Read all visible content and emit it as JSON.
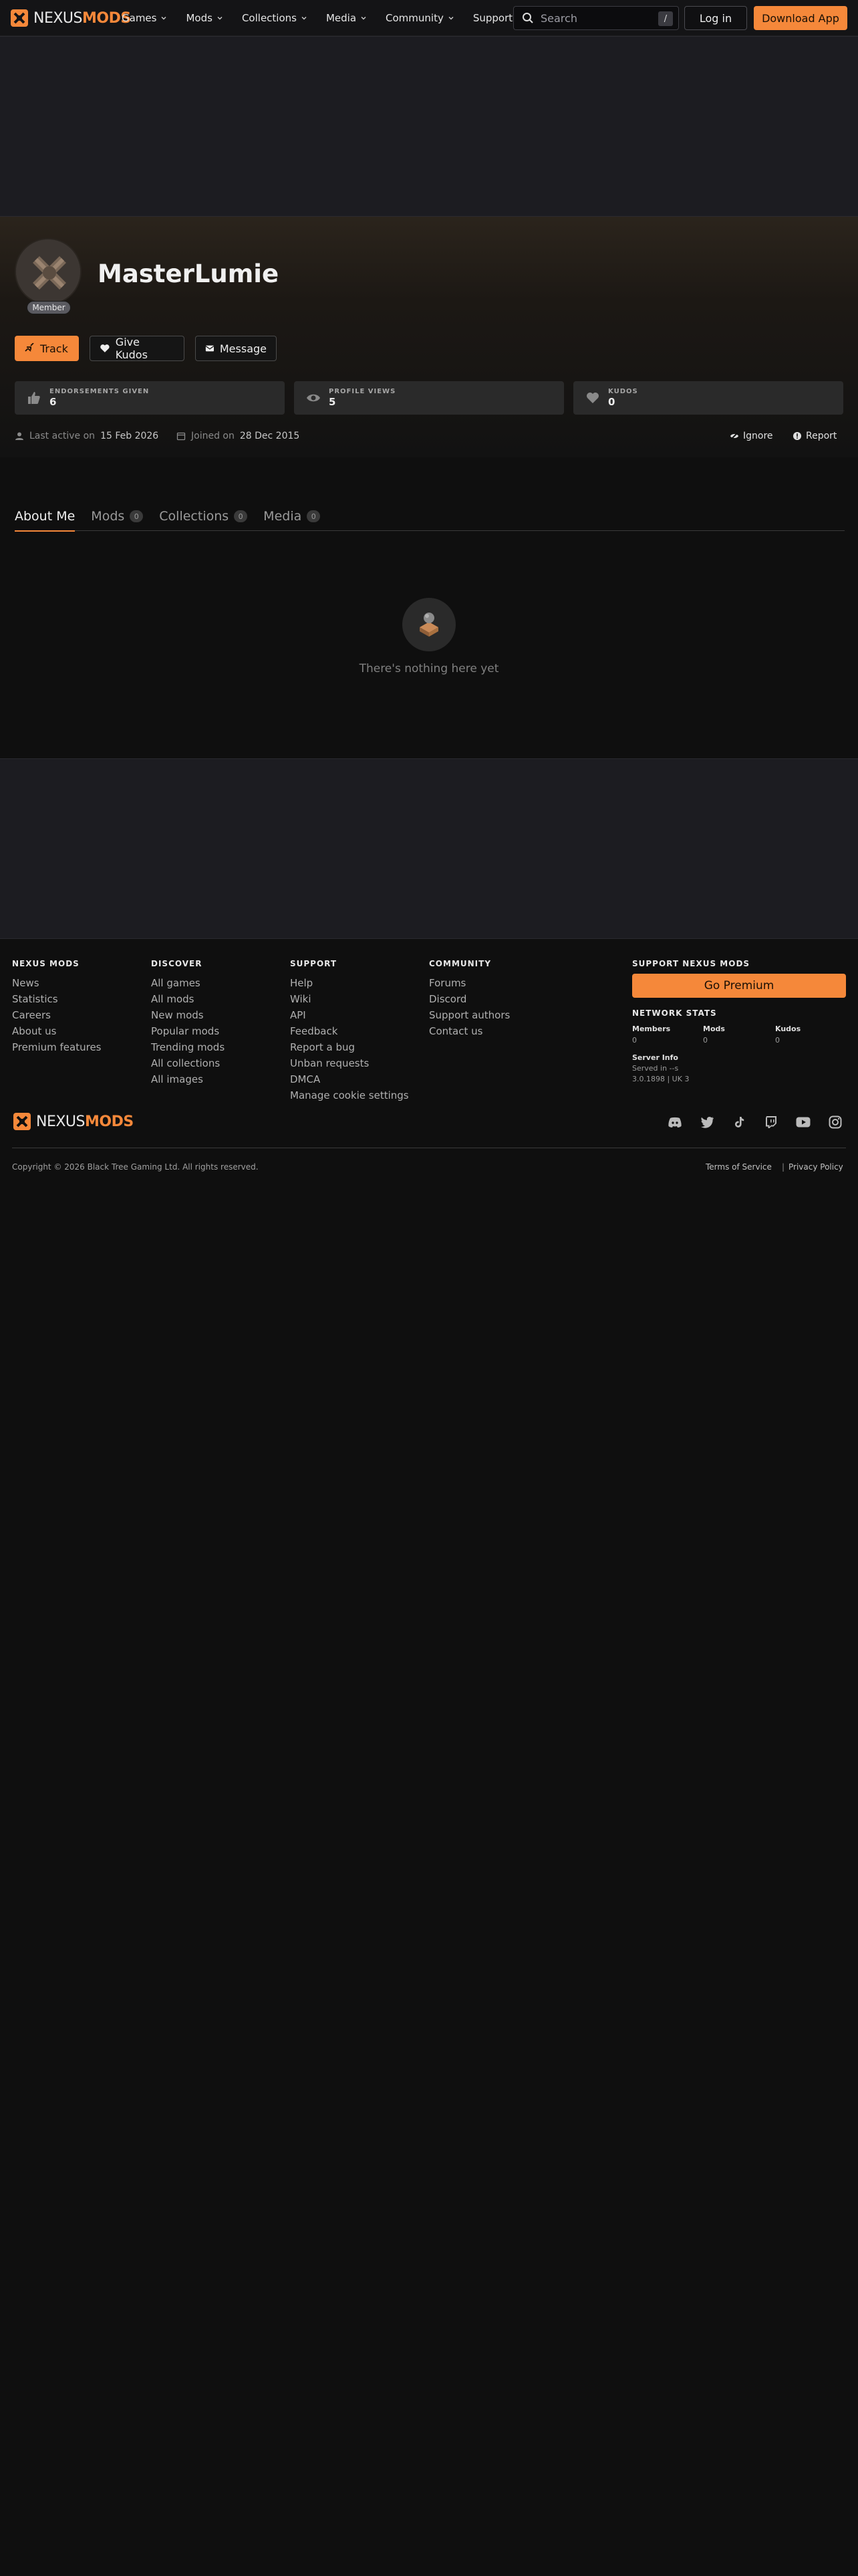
{
  "nav": {
    "logo_nexus": "NEXUS",
    "logo_mods": "MODS",
    "menu": [
      {
        "label": "Games"
      },
      {
        "label": "Mods"
      },
      {
        "label": "Collections"
      },
      {
        "label": "Media"
      },
      {
        "label": "Community"
      },
      {
        "label": "Support"
      }
    ],
    "search_placeholder": "Search",
    "search_shortcut": "/",
    "login_label": "Log in",
    "download_label": "Download App"
  },
  "profile": {
    "username": "MasterLumie",
    "role_badge": "Member",
    "actions": {
      "track": "Track",
      "kudos": "Give Kudos",
      "message": "Message"
    },
    "stats": [
      {
        "label": "ENDORSEMENTS GIVEN",
        "value": "6",
        "icon": "thumbs-up-icon"
      },
      {
        "label": "PROFILE VIEWS",
        "value": "5",
        "icon": "eye-icon"
      },
      {
        "label": "KUDOS",
        "value": "0",
        "icon": "heart-icon"
      }
    ],
    "last_active_label": "Last active on",
    "last_active_value": "15 Feb 2026",
    "joined_label": "Joined on",
    "joined_value": "28 Dec 2015",
    "ignore_label": "Ignore",
    "report_label": "Report"
  },
  "tabs": [
    {
      "label": "About Me",
      "count": "",
      "active": true
    },
    {
      "label": "Mods",
      "count": "0",
      "active": false
    },
    {
      "label": "Collections",
      "count": "0",
      "active": false
    },
    {
      "label": "Media",
      "count": "0",
      "active": false
    }
  ],
  "empty_state": {
    "text": "There's nothing here yet"
  },
  "footer": {
    "columns": [
      {
        "title": "NEXUS MODS",
        "links": [
          "News",
          "Statistics",
          "Careers",
          "About us",
          "Premium features"
        ]
      },
      {
        "title": "DISCOVER",
        "links": [
          "All games",
          "All mods",
          "New mods",
          "Popular mods",
          "Trending mods",
          "All collections",
          "All images"
        ]
      },
      {
        "title": "SUPPORT",
        "links": [
          "Help",
          "Wiki",
          "API",
          "Feedback",
          "Report a bug",
          "Unban requests",
          "DMCA",
          "Manage cookie settings"
        ]
      },
      {
        "title": "COMMUNITY",
        "links": [
          "Forums",
          "Discord",
          "Support authors",
          "Contact us"
        ]
      }
    ],
    "support_title": "SUPPORT NEXUS MODS",
    "premium_label": "Go Premium",
    "network_stats_title": "NETWORK STATS",
    "network_stats": [
      {
        "label": "Members",
        "value": "0"
      },
      {
        "label": "Mods",
        "value": "0"
      },
      {
        "label": "Kudos",
        "value": "0"
      }
    ],
    "server_info_label": "Server Info",
    "served_in": "Served in --s",
    "server_version": "3.0.1898 | UK 3",
    "social_icons": [
      "discord-icon",
      "twitter-icon",
      "tiktok-icon",
      "twitch-icon",
      "youtube-icon",
      "instagram-icon"
    ],
    "copyright": "Copyright © 2026 Black Tree Gaming Ltd. All rights reserved.",
    "terms_label": "Terms of Service",
    "privacy_label": "Privacy Policy",
    "separator": "|"
  },
  "colors": {
    "accent": "#f5883a",
    "background": "#0f0f0f",
    "nav_bg": "#141416",
    "ad_bg": "#1c1c21",
    "card_bg": "#2a2a2a"
  }
}
